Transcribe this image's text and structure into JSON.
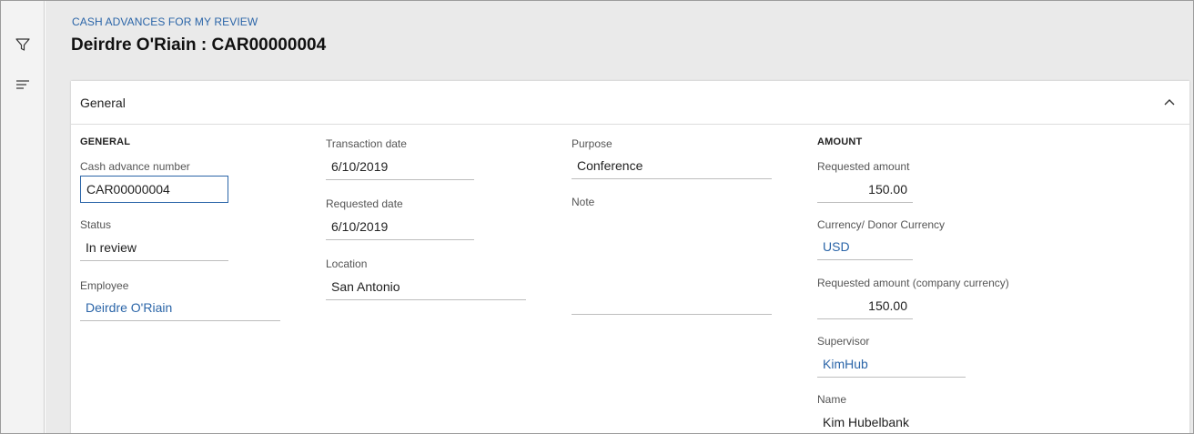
{
  "breadcrumb": "CASH ADVANCES FOR MY REVIEW",
  "title": "Deirdre O'Riain : CAR00000004",
  "leftbar": {
    "filter_icon": "filter-icon",
    "menu_icon": "lines-menu-icon"
  },
  "panel": {
    "header": "General",
    "collapse_icon": "chevron-up-icon"
  },
  "general": {
    "group_title": "GENERAL",
    "cash_advance_number_label": "Cash advance number",
    "cash_advance_number": "CAR00000004",
    "status_label": "Status",
    "status": "In review",
    "employee_label": "Employee",
    "employee": "Deirdre O'Riain"
  },
  "dates": {
    "transaction_date_label": "Transaction date",
    "transaction_date": "6/10/2019",
    "requested_date_label": "Requested date",
    "requested_date": "6/10/2019",
    "location_label": "Location",
    "location": "San Antonio"
  },
  "purpose": {
    "purpose_label": "Purpose",
    "purpose": "Conference",
    "note_label": "Note",
    "note": ""
  },
  "amount": {
    "group_title": "AMOUNT",
    "requested_amount_label": "Requested amount",
    "requested_amount": "150.00",
    "currency_label": "Currency/ Donor Currency",
    "currency": "USD",
    "requested_company_label": "Requested amount (company currency)",
    "requested_company": "150.00",
    "supervisor_label": "Supervisor",
    "supervisor": "KimHub",
    "name_label": "Name",
    "name": "Kim Hubelbank"
  },
  "colors": {
    "link": "#2b65a8",
    "workspace_bg": "#eaeaea",
    "focus_border": "#2b65a8"
  }
}
